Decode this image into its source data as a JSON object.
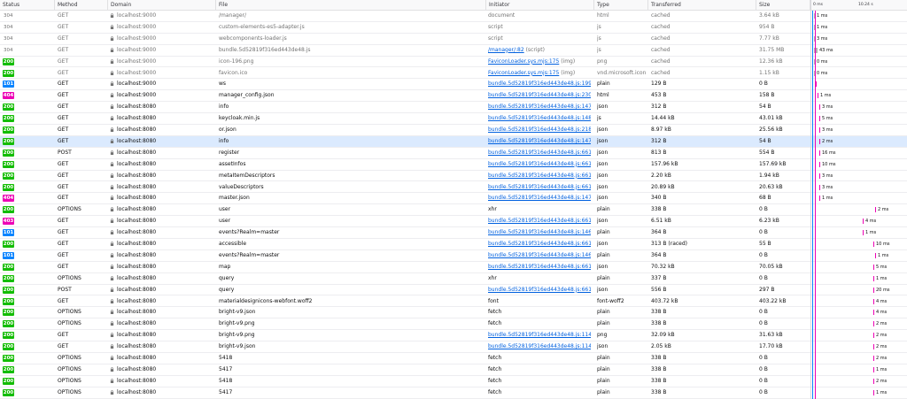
{
  "columns": {
    "status": "Status",
    "method": "Method",
    "domain": "Domain",
    "file": "File",
    "initiator": "Initiator",
    "type": "Type",
    "transferred": "Transferred",
    "size": "Size",
    "t0": "0 ms",
    "t1": "10.24 s"
  },
  "colors": {
    "ok": "#12bc00",
    "switch": "#0a84ff",
    "error": "#ed00b5",
    "link": "#0060df",
    "selected": "#dbeafe"
  },
  "rows": [
    {
      "status": "304",
      "method": "GET",
      "domain": "localhost:9000",
      "file": "/manager/",
      "initiator": "document",
      "init_link": false,
      "type": "html",
      "transferred": "cached",
      "size": "3.64 kB",
      "wf": "1 ms",
      "cached": true
    },
    {
      "status": "304",
      "method": "GET",
      "domain": "localhost:9000",
      "file": "custom-elements-es5-adapter.js",
      "initiator": "script",
      "init_link": false,
      "type": "js",
      "transferred": "cached",
      "size": "954 B",
      "wf": "1 ms",
      "cached": true
    },
    {
      "status": "304",
      "method": "GET",
      "domain": "localhost:9000",
      "file": "webcomponents-loader.js",
      "initiator": "script",
      "init_link": false,
      "type": "js",
      "transferred": "cached",
      "size": "7.77 kB",
      "wf": "3 ms",
      "cached": true
    },
    {
      "status": "304",
      "method": "GET",
      "domain": "localhost:9000",
      "file": "bundle.5d52819f316ed443de48.js",
      "initiator": "/manager/:82",
      "init_suffix": " (script)",
      "init_link": true,
      "type": "js",
      "transferred": "cached",
      "size": "31.75 MB",
      "wf": "43 ms",
      "cached": true
    },
    {
      "status": "200",
      "method": "GET",
      "domain": "localhost:9000",
      "file": "icon-196.png",
      "initiator": "FaviconLoader.sys.mjs:175",
      "init_suffix": " (img)",
      "init_link": true,
      "type": "png",
      "transferred": "cached",
      "size": "12.36 kB",
      "wf": "0 ms",
      "cached": true
    },
    {
      "status": "200",
      "method": "GET",
      "domain": "localhost:9000",
      "file": "favicon.ico",
      "initiator": "FaviconLoader.sys.mjs:175",
      "init_suffix": " (img)",
      "init_link": true,
      "type": "vnd.microsoft.icon",
      "transferred": "cached",
      "size": "1.15 kB",
      "wf": "0 ms",
      "cached": true
    },
    {
      "status": "101",
      "method": "GET",
      "domain": "localhost:9000",
      "file": "ws",
      "initiator": "bundle.5d52819f316ed443de48.js:199809",
      "init_link": true,
      "type": "plain",
      "transferred": "129 B",
      "size": "0 B",
      "wf": "",
      "cached": false
    },
    {
      "status": "404",
      "method": "GET",
      "domain": "localhost:9000",
      "file": "manager_config.json",
      "initiator": "bundle.5d52819f316ed443de48.js:230335",
      "init_link": true,
      "type": "html",
      "transferred": "453 B",
      "size": "158 B",
      "wf": "1 ms",
      "cached": false
    },
    {
      "status": "200",
      "method": "GET",
      "domain": "localhost:8080",
      "file": "info",
      "initiator": "bundle.5d52819f316ed443de48.js:147127",
      "init_link": true,
      "type": "json",
      "transferred": "312 B",
      "size": "54 B",
      "wf": "3 ms",
      "cached": false
    },
    {
      "status": "200",
      "method": "GET",
      "domain": "localhost:8080",
      "file": "keycloak.min.js",
      "initiator": "bundle.5d52819f316ed443de48.js:148780",
      "init_link": true,
      "type": "js",
      "transferred": "14.44 kB",
      "size": "43.01 kB",
      "wf": "5 ms",
      "cached": false
    },
    {
      "status": "200",
      "method": "GET",
      "domain": "localhost:8080",
      "file": "or.json",
      "initiator": "bundle.5d52819f316ed443de48.js:218729",
      "init_link": true,
      "type": "json",
      "transferred": "8.97 kB",
      "size": "25.56 kB",
      "wf": "3 ms",
      "cached": false
    },
    {
      "status": "200",
      "method": "GET",
      "domain": "localhost:8080",
      "file": "info",
      "initiator": "bundle.5d52819f316ed443de48.js:147127",
      "init_link": true,
      "type": "json",
      "transferred": "312 B",
      "size": "54 B",
      "wf": "2 ms",
      "cached": false,
      "selected": true
    },
    {
      "status": "200",
      "method": "POST",
      "domain": "localhost:8080",
      "file": "register",
      "initiator": "bundle.5d52819f316ed443de48.js:66155",
      "init_link": true,
      "type": "json",
      "transferred": "813 B",
      "size": "554 B",
      "wf": "16 ms",
      "cached": false
    },
    {
      "status": "200",
      "method": "GET",
      "domain": "localhost:8080",
      "file": "assetInfos",
      "initiator": "bundle.5d52819f316ed443de48.js:66155",
      "init_link": true,
      "type": "json",
      "transferred": "157.96 kB",
      "size": "157.69 kB",
      "wf": "10 ms",
      "cached": false
    },
    {
      "status": "200",
      "method": "GET",
      "domain": "localhost:8080",
      "file": "metaItemDescriptors",
      "initiator": "bundle.5d52819f316ed443de48.js:66155",
      "init_link": true,
      "type": "json",
      "transferred": "2.20 kB",
      "size": "1.94 kB",
      "wf": "3 ms",
      "cached": false
    },
    {
      "status": "200",
      "method": "GET",
      "domain": "localhost:8080",
      "file": "valueDescriptors",
      "initiator": "bundle.5d52819f316ed443de48.js:66155",
      "init_link": true,
      "type": "json",
      "transferred": "20.89 kB",
      "size": "20.63 kB",
      "wf": "3 ms",
      "cached": false
    },
    {
      "status": "404",
      "method": "GET",
      "domain": "localhost:8080",
      "file": "master.json",
      "initiator": "bundle.5d52819f316ed443de48.js:147450",
      "init_link": true,
      "type": "json",
      "transferred": "340 B",
      "size": "68 B",
      "wf": "1 ms",
      "cached": false
    },
    {
      "status": "200",
      "method": "OPTIONS",
      "domain": "localhost:8080",
      "file": "user",
      "initiator": "xhr",
      "init_link": false,
      "type": "plain",
      "transferred": "338 B",
      "size": "0 B",
      "wf": "2 ms",
      "cached": false
    },
    {
      "status": "403",
      "method": "GET",
      "domain": "localhost:8080",
      "file": "user",
      "initiator": "bundle.5d52819f316ed443de48.js:66155",
      "init_link": true,
      "type": "json",
      "transferred": "6.51 kB",
      "size": "6.23 kB",
      "wf": "4 ms",
      "cached": false
    },
    {
      "status": "101",
      "method": "GET",
      "domain": "localhost:8080",
      "file": "events?Realm=master",
      "initiator": "bundle.5d52819f316ed443de48.js:146618",
      "init_link": true,
      "type": "plain",
      "transferred": "364 B",
      "size": "0 B",
      "wf": "1 ms",
      "cached": false
    },
    {
      "status": "200",
      "method": "GET",
      "domain": "localhost:8080",
      "file": "accessible",
      "initiator": "bundle.5d52819f316ed443de48.js:66155",
      "init_link": true,
      "type": "json",
      "transferred": "313 B (raced)",
      "size": "55 B",
      "wf": "10 ms",
      "cached": false
    },
    {
      "status": "101",
      "method": "GET",
      "domain": "localhost:8080",
      "file": "events?Realm=master",
      "initiator": "bundle.5d52819f316ed443de48.js:146618",
      "init_link": true,
      "type": "plain",
      "transferred": "364 B",
      "size": "0 B",
      "wf": "1 ms",
      "cached": false
    },
    {
      "status": "200",
      "method": "GET",
      "domain": "localhost:8080",
      "file": "map",
      "initiator": "bundle.5d52819f316ed443de48.js:66155",
      "init_link": true,
      "type": "json",
      "transferred": "70.32 kB",
      "size": "70.05 kB",
      "wf": "5 ms",
      "cached": false
    },
    {
      "status": "200",
      "method": "OPTIONS",
      "domain": "localhost:8080",
      "file": "query",
      "initiator": "xhr",
      "init_link": false,
      "type": "plain",
      "transferred": "337 B",
      "size": "0 B",
      "wf": "1 ms",
      "cached": false
    },
    {
      "status": "200",
      "method": "POST",
      "domain": "localhost:8080",
      "file": "query",
      "initiator": "bundle.5d52819f316ed443de48.js:66155",
      "init_link": true,
      "type": "json",
      "transferred": "556 B",
      "size": "297 B",
      "wf": "20 ms",
      "cached": false
    },
    {
      "status": "200",
      "method": "GET",
      "domain": "localhost:8080",
      "file": "materialdesignicons-webfont.woff2",
      "initiator": "font",
      "init_link": false,
      "type": "font-woff2",
      "transferred": "403.72 kB",
      "size": "403.22 kB",
      "wf": "4 ms",
      "cached": false
    },
    {
      "status": "200",
      "method": "OPTIONS",
      "domain": "localhost:8080",
      "file": "bright-v9.json",
      "initiator": "fetch",
      "init_link": false,
      "type": "plain",
      "transferred": "338 B",
      "size": "0 B",
      "wf": "4 ms",
      "cached": false
    },
    {
      "status": "200",
      "method": "OPTIONS",
      "domain": "localhost:8080",
      "file": "bright-v9.png",
      "initiator": "fetch",
      "init_link": false,
      "type": "plain",
      "transferred": "338 B",
      "size": "0 B",
      "wf": "2 ms",
      "cached": false
    },
    {
      "status": "200",
      "method": "GET",
      "domain": "localhost:8080",
      "file": "bright-v9.png",
      "initiator": "bundle.5d52819f316ed443de48.js:114360",
      "init_link": true,
      "type": "png",
      "transferred": "32.09 kB",
      "size": "31.63 kB",
      "wf": "2 ms",
      "cached": false
    },
    {
      "status": "200",
      "method": "GET",
      "domain": "localhost:8080",
      "file": "bright-v9.json",
      "initiator": "bundle.5d52819f316ed443de48.js:114360",
      "init_link": true,
      "type": "json",
      "transferred": "2.05 kB",
      "size": "17.70 kB",
      "wf": "2 ms",
      "cached": false
    },
    {
      "status": "200",
      "method": "OPTIONS",
      "domain": "localhost:8080",
      "file": "5418",
      "initiator": "fetch",
      "init_link": false,
      "type": "plain",
      "transferred": "338 B",
      "size": "0 B",
      "wf": "2 ms",
      "cached": false
    },
    {
      "status": "200",
      "method": "OPTIONS",
      "domain": "localhost:8080",
      "file": "5417",
      "initiator": "fetch",
      "init_link": false,
      "type": "plain",
      "transferred": "338 B",
      "size": "0 B",
      "wf": "1 ms",
      "cached": false
    },
    {
      "status": "200",
      "method": "OPTIONS",
      "domain": "localhost:8080",
      "file": "5418",
      "initiator": "fetch",
      "init_link": false,
      "type": "plain",
      "transferred": "338 B",
      "size": "0 B",
      "wf": "2 ms",
      "cached": false
    },
    {
      "status": "200",
      "method": "OPTIONS",
      "domain": "localhost:8080",
      "file": "5417",
      "initiator": "fetch",
      "init_link": false,
      "type": "plain",
      "transferred": "338 B",
      "size": "0 B",
      "wf": "1 ms",
      "cached": false
    }
  ]
}
